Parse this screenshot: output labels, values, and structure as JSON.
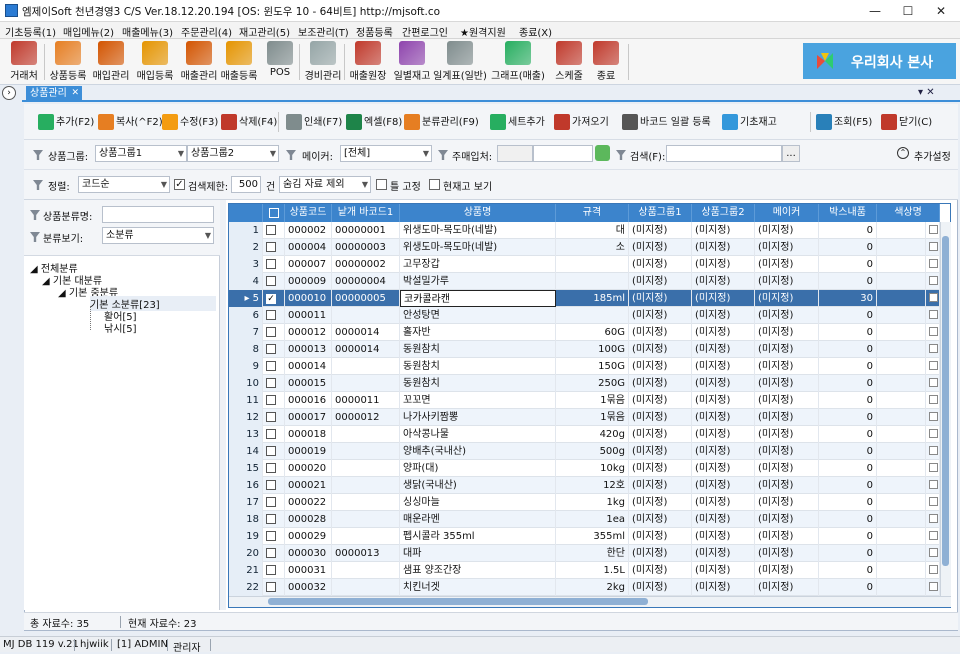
{
  "window": {
    "title": "엠제이Soft 천년경영3 C/S  Ver.18.12.20.194  [OS: 윈도우 10 - 64비트]   http://mjsoft.co",
    "min": "—",
    "max": "☐",
    "close": "✕"
  },
  "menu": [
    "기초등록(1)",
    "매입메뉴(2)",
    "매출메뉴(3)",
    "주문관리(4)",
    "재고관리(5)",
    "보조관리(T)",
    "정품등록",
    "간편로그인",
    "★원격지원",
    "종료(X)"
  ],
  "toolbar": [
    {
      "label": "거래처",
      "icon": "person-icon",
      "color": "#c0392b"
    },
    {
      "label": "상품등록",
      "icon": "product-icon",
      "color": "#e67e22"
    },
    {
      "label": "매입관리",
      "icon": "purchase-icon",
      "color": "#d35400"
    },
    {
      "label": "매입등록",
      "icon": "purchase-add-icon",
      "color": "#e59400"
    },
    {
      "label": "매출관리",
      "icon": "sales-icon",
      "color": "#d35400"
    },
    {
      "label": "매출등록",
      "icon": "sales-add-icon",
      "color": "#e59400"
    },
    {
      "label": "POS",
      "icon": "pos-icon",
      "color": "#7f8c8d"
    },
    {
      "label": "경비관리",
      "icon": "expense-icon",
      "color": "#95a5a6"
    },
    {
      "label": "매출원장",
      "icon": "ledger-icon",
      "color": "#c0392b"
    },
    {
      "label": "일별재고",
      "icon": "daily-stock-icon",
      "color": "#8e44ad"
    },
    {
      "label": "일계표(일반)",
      "icon": "daily-report-icon",
      "color": "#7f8c8d"
    },
    {
      "label": "그래프(매출)",
      "icon": "graph-icon",
      "color": "#27ae60"
    },
    {
      "label": "스케줄",
      "icon": "calendar-icon",
      "color": "#c0392b"
    },
    {
      "label": "종료",
      "icon": "exit-icon",
      "color": "#c0392b"
    }
  ],
  "brand": {
    "text": "우리회사 본사"
  },
  "tab": {
    "label": "상품관리",
    "close": "✕",
    "controls": "▾  ✕"
  },
  "actions": [
    {
      "label": "추가(F2)",
      "icon": "add-icon",
      "color": "#27ae60"
    },
    {
      "label": "복사(^F2)",
      "icon": "copy-icon",
      "color": "#e67e22"
    },
    {
      "label": "수정(F3)",
      "icon": "edit-icon",
      "color": "#f39c12"
    },
    {
      "label": "삭제(F4)",
      "icon": "delete-icon",
      "color": "#c0392b"
    },
    {
      "label": "인쇄(F7)",
      "icon": "print-icon",
      "color": "#7f8c8d"
    },
    {
      "label": "엑셀(F8)",
      "icon": "excel-icon",
      "color": "#1e8449"
    },
    {
      "label": "분류관리(F9)",
      "icon": "category-icon",
      "color": "#e67e22"
    },
    {
      "label": "세트추가",
      "icon": "set-add-icon",
      "color": "#27ae60"
    },
    {
      "label": "가져오기",
      "icon": "import-icon",
      "color": "#c0392b"
    },
    {
      "label": "바코드 일괄 등록",
      "icon": "barcode-icon",
      "color": "#555555"
    },
    {
      "label": "기초재고",
      "icon": "grid-stock-icon",
      "color": "#3498db"
    },
    {
      "label": "조회(F5)",
      "icon": "search-icon",
      "color": "#2980b9"
    },
    {
      "label": "닫기(C)",
      "icon": "close-door-icon",
      "color": "#c0392b"
    }
  ],
  "filters": {
    "group_label": "상품그룹:",
    "group1": "상품그룹1",
    "group2": "상품그룹2",
    "maker_label": "메이커:",
    "maker": "[전체]",
    "buyer_label": "주매입처:",
    "buyer": "",
    "search_label": "검색(F):",
    "search": "",
    "search_btn": "...",
    "more": "추가설정",
    "sort_label": "정렬:",
    "sort": "코드순",
    "limit_label": "검색제한:",
    "limit": "500",
    "limit_unit": "건",
    "hide": "숨김 자료 제외",
    "fix_label": "틀 고정",
    "stock_label": "현재고 보기"
  },
  "left": {
    "classname_label": "상품분류명:",
    "view_label": "분류보기:",
    "view": "소분류"
  },
  "tree": [
    "전체분류",
    "기본 대분류",
    "기본 중분류",
    "기본 소분류[23]",
    "활어[5]",
    "낚시[5]"
  ],
  "grid": {
    "headers": [
      "",
      "상품코드",
      "낱개 바코드1",
      "상품명",
      "규격",
      "상품그룹1",
      "상품그룹2",
      "메이커",
      "박스내품",
      "색상명"
    ],
    "rows": [
      {
        "n": "1",
        "code": "000002",
        "bar": "00000001",
        "name": "위생도마-목도마(네발)",
        "spec": "대",
        "g1": "(미지정)",
        "g2": "(미지정)",
        "mk": "(미지정)",
        "box": "0"
      },
      {
        "n": "2",
        "code": "000004",
        "bar": "00000003",
        "name": "위생도마-목도마(네발)",
        "spec": "소",
        "g1": "(미지정)",
        "g2": "(미지정)",
        "mk": "(미지정)",
        "box": "0"
      },
      {
        "n": "3",
        "code": "000007",
        "bar": "00000002",
        "name": "고무장갑",
        "spec": "",
        "g1": "(미지정)",
        "g2": "(미지정)",
        "mk": "(미지정)",
        "box": "0"
      },
      {
        "n": "4",
        "code": "000009",
        "bar": "00000004",
        "name": "박설밀가루",
        "spec": "",
        "g1": "(미지정)",
        "g2": "(미지정)",
        "mk": "(미지정)",
        "box": "0"
      },
      {
        "n": "5",
        "code": "000010",
        "bar": "00000005",
        "name": "코카콜라캔",
        "spec": "185ml",
        "g1": "(미지정)",
        "g2": "(미지정)",
        "mk": "(미지정)",
        "box": "30",
        "selected": true
      },
      {
        "n": "6",
        "code": "000011",
        "bar": "",
        "name": "안성탕면",
        "spec": "",
        "g1": "(미지정)",
        "g2": "(미지정)",
        "mk": "(미지정)",
        "box": "0"
      },
      {
        "n": "7",
        "code": "000012",
        "bar": "0000014",
        "name": "홀자반",
        "spec": "60G",
        "g1": "(미지정)",
        "g2": "(미지정)",
        "mk": "(미지정)",
        "box": "0"
      },
      {
        "n": "8",
        "code": "000013",
        "bar": "0000014",
        "name": "동원참치",
        "spec": "100G",
        "g1": "(미지정)",
        "g2": "(미지정)",
        "mk": "(미지정)",
        "box": "0"
      },
      {
        "n": "9",
        "code": "000014",
        "bar": "",
        "name": "동원참치",
        "spec": "150G",
        "g1": "(미지정)",
        "g2": "(미지정)",
        "mk": "(미지정)",
        "box": "0"
      },
      {
        "n": "10",
        "code": "000015",
        "bar": "",
        "name": "동원참치",
        "spec": "250G",
        "g1": "(미지정)",
        "g2": "(미지정)",
        "mk": "(미지정)",
        "box": "0"
      },
      {
        "n": "11",
        "code": "000016",
        "bar": "0000011",
        "name": "꼬꼬면",
        "spec": "1묶음",
        "g1": "(미지정)",
        "g2": "(미지정)",
        "mk": "(미지정)",
        "box": "0"
      },
      {
        "n": "12",
        "code": "000017",
        "bar": "0000012",
        "name": "나가사키짬뽕",
        "spec": "1묶음",
        "g1": "(미지정)",
        "g2": "(미지정)",
        "mk": "(미지정)",
        "box": "0"
      },
      {
        "n": "13",
        "code": "000018",
        "bar": "",
        "name": "아삭콩나물",
        "spec": "420g",
        "g1": "(미지정)",
        "g2": "(미지정)",
        "mk": "(미지정)",
        "box": "0"
      },
      {
        "n": "14",
        "code": "000019",
        "bar": "",
        "name": "양배추(국내산)",
        "spec": "500g",
        "g1": "(미지정)",
        "g2": "(미지정)",
        "mk": "(미지정)",
        "box": "0"
      },
      {
        "n": "15",
        "code": "000020",
        "bar": "",
        "name": "양파(대)",
        "spec": "10kg",
        "g1": "(미지정)",
        "g2": "(미지정)",
        "mk": "(미지정)",
        "box": "0"
      },
      {
        "n": "16",
        "code": "000021",
        "bar": "",
        "name": "생닭(국내산)",
        "spec": "12호",
        "g1": "(미지정)",
        "g2": "(미지정)",
        "mk": "(미지정)",
        "box": "0"
      },
      {
        "n": "17",
        "code": "000022",
        "bar": "",
        "name": "싱싱마늘",
        "spec": "1kg",
        "g1": "(미지정)",
        "g2": "(미지정)",
        "mk": "(미지정)",
        "box": "0"
      },
      {
        "n": "18",
        "code": "000028",
        "bar": "",
        "name": "매운라멘",
        "spec": "1ea",
        "g1": "(미지정)",
        "g2": "(미지정)",
        "mk": "(미지정)",
        "box": "0"
      },
      {
        "n": "19",
        "code": "000029",
        "bar": "",
        "name": "펩시콜라 355ml",
        "spec": "355ml",
        "g1": "(미지정)",
        "g2": "(미지정)",
        "mk": "(미지정)",
        "box": "0"
      },
      {
        "n": "20",
        "code": "000030",
        "bar": "0000013",
        "name": "대파",
        "spec": "한단",
        "g1": "(미지정)",
        "g2": "(미지정)",
        "mk": "(미지정)",
        "box": "0"
      },
      {
        "n": "21",
        "code": "000031",
        "bar": "",
        "name": "샘표 양조간장",
        "spec": "1.5L",
        "g1": "(미지정)",
        "g2": "(미지정)",
        "mk": "(미지정)",
        "box": "0"
      },
      {
        "n": "22",
        "code": "000032",
        "bar": "",
        "name": "치킨너겟",
        "spec": "2kg",
        "g1": "(미지정)",
        "g2": "(미지정)",
        "mk": "(미지정)",
        "box": "0"
      }
    ]
  },
  "footer": {
    "total": "총 자료수: 35",
    "current": "현재 자료수: 23"
  },
  "status": [
    "MJ DB 119 v.21",
    "hjwiik",
    "[1] ADMIN",
    "관리자"
  ]
}
